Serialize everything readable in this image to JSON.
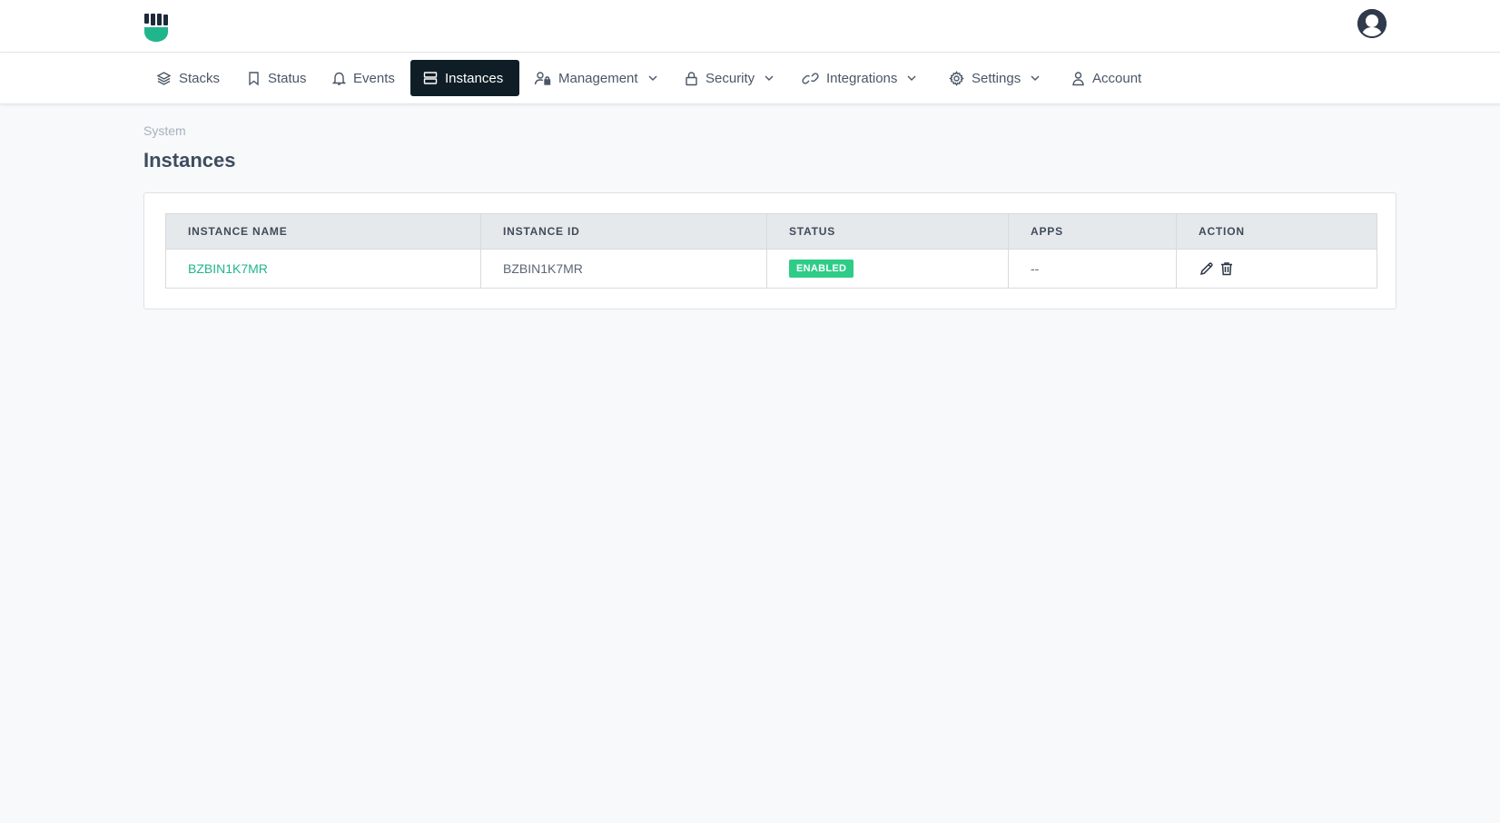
{
  "brand": {
    "logo_icon": "fist-logo-icon",
    "accent": "#21b58d"
  },
  "user": {
    "avatar_icon": "user-avatar-icon"
  },
  "nav": {
    "items": [
      {
        "label": "Stacks",
        "icon": "layers-icon",
        "active": false,
        "dropdown": false
      },
      {
        "label": "Status",
        "icon": "bookmark-icon",
        "active": false,
        "dropdown": false
      },
      {
        "label": "Events",
        "icon": "bell-icon",
        "active": false,
        "dropdown": false
      },
      {
        "label": "Instances",
        "icon": "server-icon",
        "active": true,
        "dropdown": false
      },
      {
        "label": "Management",
        "icon": "user-lock-icon",
        "active": false,
        "dropdown": true
      },
      {
        "label": "Security",
        "icon": "lock-icon",
        "active": false,
        "dropdown": true
      },
      {
        "label": "Integrations",
        "icon": "link-icon",
        "active": false,
        "dropdown": true
      },
      {
        "label": "Settings",
        "icon": "gear-icon",
        "active": false,
        "dropdown": true
      },
      {
        "label": "Account",
        "icon": "user-icon",
        "active": false,
        "dropdown": false
      }
    ],
    "active_bg": "#0f1e26"
  },
  "page": {
    "breadcrumb": "System",
    "title": "Instances"
  },
  "table": {
    "columns": [
      "INSTANCE NAME",
      "INSTANCE ID",
      "STATUS",
      "APPS",
      "ACTION"
    ],
    "rows": [
      {
        "name": "BZBIN1K7MR",
        "id": "BZBIN1K7MR",
        "status": "ENABLED",
        "apps": "--",
        "actions": [
          "pencil-icon",
          "trash-icon"
        ]
      }
    ],
    "status_color": "#2ecc87"
  }
}
